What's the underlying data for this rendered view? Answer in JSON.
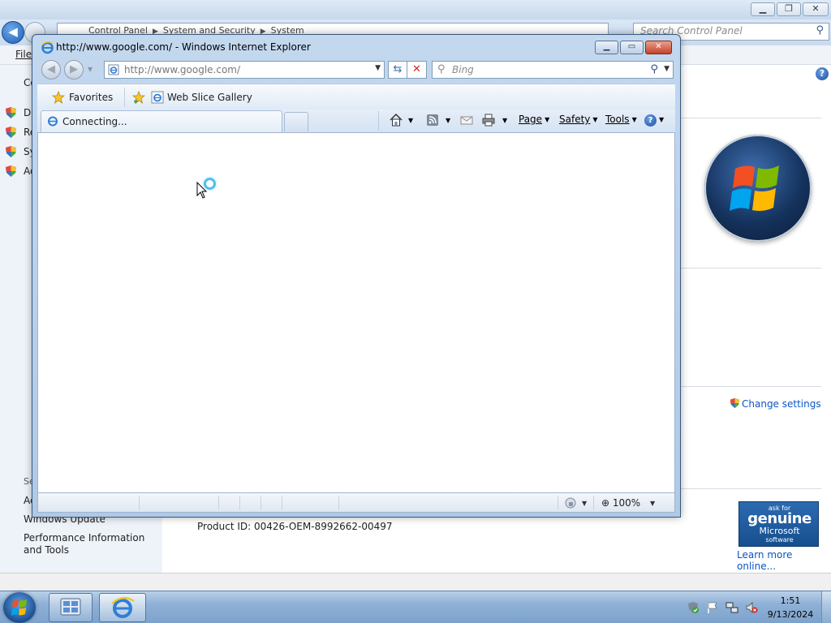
{
  "control_panel": {
    "breadcrumb": [
      "Control Panel",
      "System and Security",
      "System"
    ],
    "search_placeholder": "Search Control Panel",
    "menu_file": "File",
    "sidebar": {
      "home_label": "Co",
      "links": [
        "De",
        "Re",
        "Sy",
        "Ad"
      ],
      "see_also": "Se",
      "bottom_links": [
        "Ac",
        "Windows Update",
        "Performance Information and Tools"
      ]
    },
    "change_settings": "Change settings",
    "product_id": "Product ID: 00426-OEM-8992662-00497",
    "genuine_badge": {
      "ask": "ask for",
      "main": "genuine",
      "ms": "Microsoft",
      "sw": "software"
    },
    "learn_more": "Learn more online..."
  },
  "ie": {
    "title": "http://www.google.com/ - Windows Internet Explorer",
    "address": "http://www.google.com/",
    "search_placeholder": "Bing",
    "favorites_label": "Favorites",
    "web_slice_label": "Web Slice Gallery",
    "tab_label": "Connecting...",
    "commands": {
      "page": "Page",
      "safety": "Safety",
      "tools": "Tools"
    },
    "zoom": "100%"
  },
  "taskbar": {
    "time": "1:51",
    "date": "9/13/2024"
  }
}
